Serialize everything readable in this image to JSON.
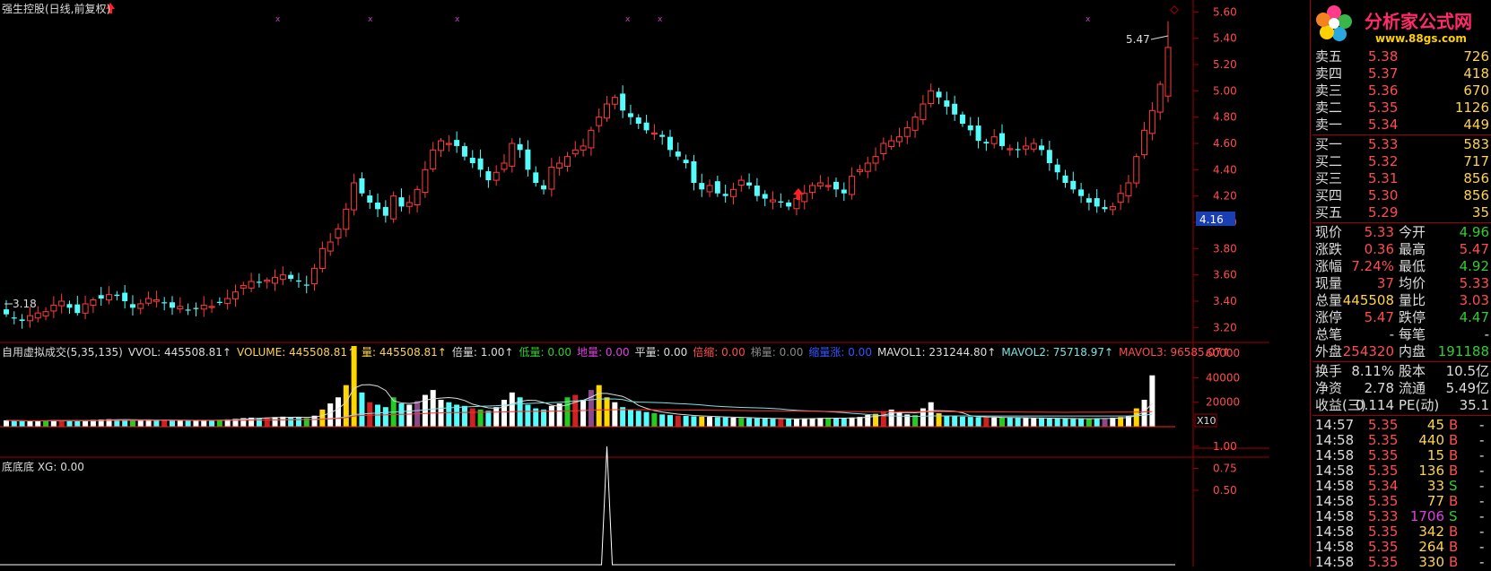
{
  "title": "强生控股(日线,前复权)",
  "price_axis": [
    "5.60",
    "5.40",
    "5.20",
    "5.00",
    "4.80",
    "4.60",
    "4.40",
    "4.20",
    "4.00",
    "3.80",
    "3.60",
    "3.40",
    "3.20"
  ],
  "current_price_tag": "4.16",
  "annotations": {
    "high": "5.47",
    "low": "3.18"
  },
  "volume_header": [
    {
      "text": "自用虚拟成交(5,35,135)",
      "color": "#dddddd"
    },
    {
      "text": "VVOL: 445508.81↑",
      "color": "#dddddd"
    },
    {
      "text": "VOLUME: 445508.81↑",
      "color": "#ffd34d"
    },
    {
      "text": "量: 445508.81↑",
      "color": "#ffd34d"
    },
    {
      "text": "倍量: 1.00↑",
      "color": "#dddddd"
    },
    {
      "text": "低量: 0.00",
      "color": "#33cc33"
    },
    {
      "text": "地量: 0.00",
      "color": "#e040e0"
    },
    {
      "text": "平量: 0.00",
      "color": "#dddddd"
    },
    {
      "text": "倍缩: 0.00",
      "color": "#ff4d4d"
    },
    {
      "text": "梯量: 0.00",
      "color": "#888888"
    },
    {
      "text": "缩量涨: 0.00",
      "color": "#3355ff"
    },
    {
      "text": "MAVOL1: 231244.80↑",
      "color": "#dddddd"
    },
    {
      "text": "MAVOL2: 75718.97↑",
      "color": "#80e0e0"
    },
    {
      "text": "MAVOL3: 96585.07↑",
      "color": "#ff4d4d"
    }
  ],
  "volume_axis": [
    "60000",
    "40000",
    "20000"
  ],
  "volume_unit": "X10",
  "indicator_header": "底底底 XG: 0.00",
  "indicator_axis": [
    "1.00",
    "0.75",
    "0.50"
  ],
  "logo": {
    "title": "分析家公式网",
    "url": "www.88gs.com"
  },
  "orderbook": {
    "asks": [
      {
        "label": "卖五",
        "price": "5.38",
        "vol": "726"
      },
      {
        "label": "卖四",
        "price": "5.37",
        "vol": "418"
      },
      {
        "label": "卖三",
        "price": "5.36",
        "vol": "670"
      },
      {
        "label": "卖二",
        "price": "5.35",
        "vol": "1126"
      },
      {
        "label": "卖一",
        "price": "5.34",
        "vol": "449"
      }
    ],
    "bids": [
      {
        "label": "买一",
        "price": "5.33",
        "vol": "583"
      },
      {
        "label": "买二",
        "price": "5.32",
        "vol": "717"
      },
      {
        "label": "买三",
        "price": "5.31",
        "vol": "856"
      },
      {
        "label": "买四",
        "price": "5.30",
        "vol": "856"
      },
      {
        "label": "买五",
        "price": "5.29",
        "vol": "35"
      }
    ]
  },
  "quote": [
    {
      "l1": "现价",
      "v1": "5.33",
      "c1": "r",
      "l2": "今开",
      "v2": "4.96",
      "c2": "g"
    },
    {
      "l1": "涨跌",
      "v1": "0.36",
      "c1": "r",
      "l2": "最高",
      "v2": "5.47",
      "c2": "r"
    },
    {
      "l1": "涨幅",
      "v1": "7.24%",
      "c1": "r",
      "l2": "最低",
      "v2": "4.92",
      "c2": "g"
    },
    {
      "l1": "现量",
      "v1": "37",
      "c1": "r",
      "l2": "均价",
      "v2": "5.33",
      "c2": "r"
    },
    {
      "l1": "总量",
      "v1": "445508",
      "c1": "y",
      "l2": "量比",
      "v2": "3.03",
      "c2": "r"
    },
    {
      "l1": "涨停",
      "v1": "5.47",
      "c1": "r",
      "l2": "跌停",
      "v2": "4.47",
      "c2": "g"
    },
    {
      "l1": "总笔",
      "v1": "-",
      "c1": "w",
      "l2": "每笔",
      "v2": "-",
      "c2": "w"
    },
    {
      "l1": "外盘",
      "v1": "254320",
      "c1": "r",
      "l2": "内盘",
      "v2": "191188",
      "c2": "g"
    }
  ],
  "fundamentals": [
    {
      "l1": "换手",
      "v1": "8.11%",
      "l2": "股本",
      "v2": "10.5亿"
    },
    {
      "l1": "净资",
      "v1": "2.78",
      "l2": "流通",
      "v2": "5.49亿"
    },
    {
      "l1": "收益(三)",
      "v1": "0.114",
      "l2": "PE(动)",
      "v2": "35.1"
    }
  ],
  "ticks": [
    {
      "time": "14:57",
      "price": "5.35",
      "vol": "45",
      "side": "B",
      "pc": "r",
      "vc": "y"
    },
    {
      "time": "14:58",
      "price": "5.35",
      "vol": "440",
      "side": "B",
      "pc": "r",
      "vc": "y"
    },
    {
      "time": "14:58",
      "price": "5.35",
      "vol": "15",
      "side": "B",
      "pc": "r",
      "vc": "y"
    },
    {
      "time": "14:58",
      "price": "5.35",
      "vol": "136",
      "side": "B",
      "pc": "r",
      "vc": "y"
    },
    {
      "time": "14:58",
      "price": "5.34",
      "vol": "33",
      "side": "S",
      "pc": "r",
      "vc": "y"
    },
    {
      "time": "14:58",
      "price": "5.35",
      "vol": "77",
      "side": "B",
      "pc": "r",
      "vc": "y"
    },
    {
      "time": "14:58",
      "price": "5.33",
      "vol": "1706",
      "side": "S",
      "pc": "r",
      "vc": "m"
    },
    {
      "time": "14:58",
      "price": "5.35",
      "vol": "342",
      "side": "B",
      "pc": "r",
      "vc": "y"
    },
    {
      "time": "14:58",
      "price": "5.35",
      "vol": "264",
      "side": "B",
      "pc": "r",
      "vc": "y"
    },
    {
      "time": "14:58",
      "price": "5.35",
      "vol": "330",
      "side": "B",
      "pc": "r",
      "vc": "y"
    }
  ],
  "colors": {
    "up": "#ff3b3b",
    "down": "#54fcfc",
    "frame": "#a00000",
    "vol_yellow": "#ffd700",
    "vol_purple": "#8a4a8a",
    "vol_green": "#22cc22"
  },
  "chart_data": {
    "type": "candlestick",
    "price_range": [
      3.1,
      5.65
    ],
    "closes": [
      3.3,
      3.27,
      3.25,
      3.29,
      3.31,
      3.32,
      3.37,
      3.4,
      3.35,
      3.31,
      3.38,
      3.41,
      3.42,
      3.45,
      3.44,
      3.4,
      3.35,
      3.38,
      3.42,
      3.41,
      3.39,
      3.35,
      3.36,
      3.33,
      3.34,
      3.37,
      3.36,
      3.39,
      3.42,
      3.47,
      3.52,
      3.55,
      3.54,
      3.56,
      3.58,
      3.6,
      3.57,
      3.55,
      3.52,
      3.65,
      3.8,
      3.85,
      3.95,
      4.1,
      4.3,
      4.22,
      4.15,
      4.1,
      4.05,
      4.2,
      4.12,
      4.15,
      4.25,
      4.4,
      4.55,
      4.62,
      4.6,
      4.58,
      4.5,
      4.45,
      4.4,
      4.32,
      4.38,
      4.45,
      4.6,
      4.55,
      4.4,
      4.3,
      4.25,
      4.42,
      4.45,
      4.5,
      4.55,
      4.58,
      4.7,
      4.8,
      4.9,
      4.95,
      4.85,
      4.8,
      4.75,
      4.7,
      4.68,
      4.65,
      4.55,
      4.5,
      4.45,
      4.3,
      4.25,
      4.28,
      4.22,
      4.2,
      4.25,
      4.32,
      4.28,
      4.2,
      4.18,
      4.17,
      4.15,
      4.12,
      4.18,
      4.22,
      4.28,
      4.3,
      4.28,
      4.25,
      4.22,
      4.35,
      4.4,
      4.45,
      4.5,
      4.6,
      4.62,
      4.65,
      4.72,
      4.8,
      4.9,
      5.0,
      4.95,
      4.88,
      4.82,
      4.75,
      4.7,
      4.62,
      4.6,
      4.65,
      4.58,
      4.56,
      4.55,
      4.58,
      4.6,
      4.55,
      4.45,
      4.38,
      4.3,
      4.25,
      4.2,
      4.15,
      4.12,
      4.1,
      4.12,
      4.22,
      4.3,
      4.5,
      4.7,
      4.85,
      5.05,
      5.33
    ],
    "volumes": [
      5200,
      4800,
      4500,
      4600,
      4900,
      5100,
      5400,
      5000,
      4700,
      4500,
      5200,
      5600,
      5900,
      6100,
      5800,
      5500,
      5200,
      5400,
      5900,
      5600,
      5300,
      5000,
      5100,
      4900,
      5000,
      5400,
      5200,
      5700,
      6000,
      6400,
      7000,
      7400,
      7100,
      7600,
      7900,
      8200,
      7800,
      7400,
      7000,
      9000,
      14000,
      19000,
      24000,
      34000,
      66000,
      28000,
      20000,
      18000,
      16000,
      24000,
      19000,
      18000,
      21000,
      26000,
      30000,
      22000,
      20000,
      18000,
      17000,
      15000,
      14000,
      13000,
      16000,
      22000,
      28000,
      24000,
      18000,
      15000,
      14000,
      17000,
      19000,
      24000,
      26000,
      22000,
      30000,
      34000,
      24000,
      20000,
      16000,
      14000,
      13000,
      12000,
      11000,
      10000,
      9500,
      9000,
      8800,
      8500,
      8200,
      8000,
      7800,
      7600,
      7400,
      7200,
      7000,
      6800,
      6600,
      6500,
      6400,
      6300,
      6500,
      6800,
      7000,
      7200,
      7100,
      6900,
      6800,
      7500,
      8000,
      9500,
      10500,
      12000,
      14000,
      11500,
      10000,
      9500,
      15000,
      20000,
      11000,
      9000,
      8500,
      8200,
      8000,
      7800,
      7600,
      7500,
      7400,
      7300,
      7200,
      7100,
      7000,
      6900,
      6800,
      6700,
      6600,
      6500,
      6400,
      6600,
      6800,
      7000,
      7400,
      7900,
      8500,
      15000,
      22000,
      42000
    ],
    "indicator_spike_index": 76
  }
}
